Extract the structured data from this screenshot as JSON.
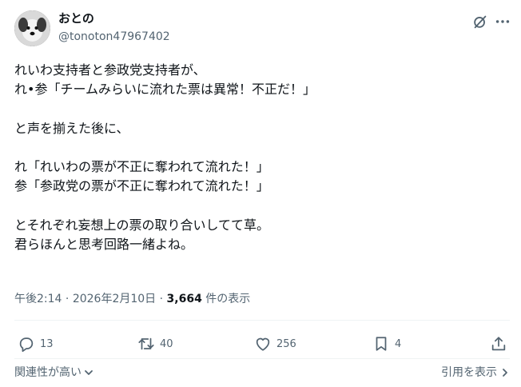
{
  "author": {
    "display_name": "おとの",
    "handle": "@tonoton47967402"
  },
  "post": {
    "text": "れいわ支持者と参政党支持者が、\nれ•参「チームみらいに流れた票は異常！不正だ！」\n\nと声を揃えた後に、\n\nれ「れいわの票が不正に奪われて流れた！」\n参「参政党の票が不正に奪われて流れた！」\n\nとそれぞれ妄想上の票の取り合いしてて草。\n君らほんと思考回路一緒よね。"
  },
  "meta": {
    "time": "午後2:14",
    "separator": "·",
    "date": "2026年2月10日",
    "views_count": "3,664",
    "views_label": "件の表示"
  },
  "actions": {
    "reply_count": "13",
    "repost_count": "40",
    "like_count": "256",
    "bookmark_count": "4"
  },
  "footer": {
    "sort_label": "関連性が高い",
    "quotes_label": "引用を表示"
  },
  "icons": {
    "grok": "grok-icon",
    "more": "more-icon",
    "reply": "reply-icon",
    "repost": "repost-icon",
    "like": "heart-icon",
    "bookmark": "bookmark-icon",
    "share": "share-icon"
  },
  "colors": {
    "text": "#0f1419",
    "secondary": "#536471",
    "divider": "#eff3f4"
  }
}
